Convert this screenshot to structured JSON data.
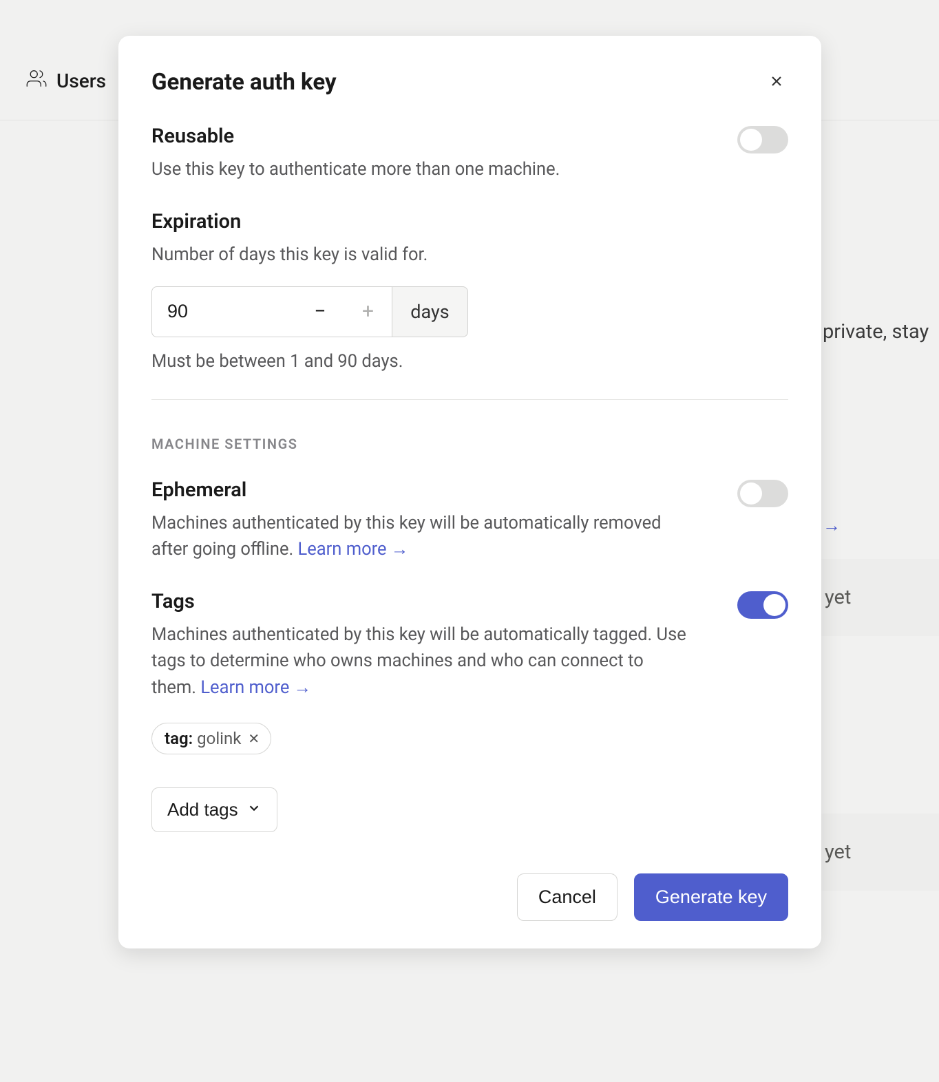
{
  "background": {
    "nav_label": "Users",
    "hint_text": "private, stay",
    "row_text_1": "yet",
    "row_text_2": "yet"
  },
  "modal": {
    "title": "Generate auth key",
    "reusable": {
      "heading": "Reusable",
      "description": "Use this key to authenticate more than one machine.",
      "enabled": false
    },
    "expiration": {
      "heading": "Expiration",
      "description": "Number of days this key is valid for.",
      "value": "90",
      "unit": "days",
      "hint": "Must be between 1 and 90 days."
    },
    "machine_settings_label": "MACHINE SETTINGS",
    "ephemeral": {
      "heading": "Ephemeral",
      "description_prefix": "Machines authenticated by this key will be automatically removed after going offline. ",
      "learn_more": "Learn more",
      "enabled": false
    },
    "tags": {
      "heading": "Tags",
      "description_prefix": "Machines authenticated by this key will be automatically tagged. Use tags to determine who owns machines and who can connect to them. ",
      "learn_more": "Learn more",
      "enabled": true,
      "chips": [
        {
          "prefix": "tag:",
          "name": "golink"
        }
      ],
      "add_button": "Add tags"
    },
    "footer": {
      "cancel": "Cancel",
      "generate": "Generate key"
    }
  }
}
